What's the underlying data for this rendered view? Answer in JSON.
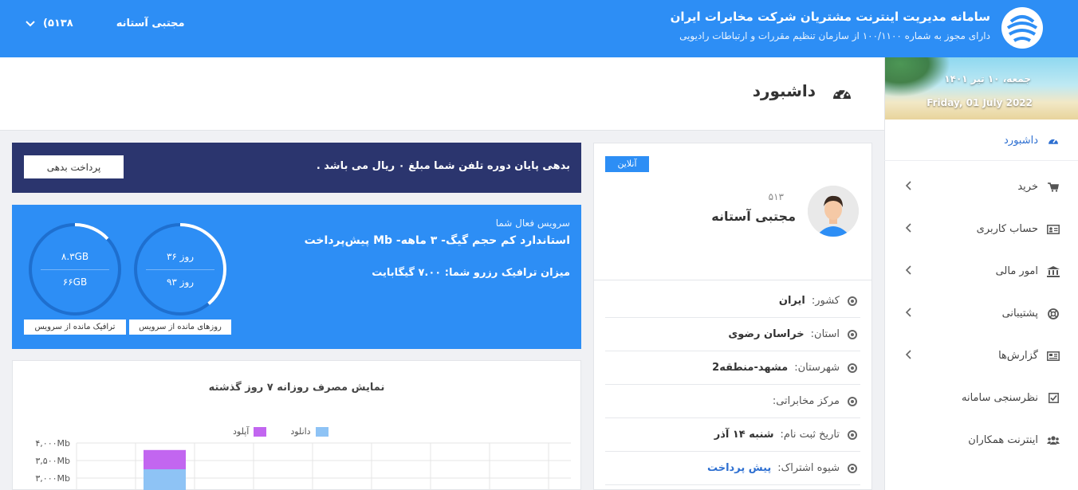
{
  "header": {
    "title": "سامانه مدیریت اینترنت مشتریان شرکت مخابرات ایران",
    "subtitle": "دارای مجوز به شماره ۱۰۰/۱۱۰۰ از سازمان تنظیم مقررات و ارتباطات رادیویی",
    "user_name": "مجتبی آستانه",
    "user_code": "(۵۱۳۸",
    "dropdown_icon": "chevron-down-icon"
  },
  "sidebar": {
    "date_fa": "جمعه، ۱۰ تیر ۱۴۰۱",
    "date_en": "Friday, 01 July 2022",
    "items": [
      {
        "label": "داشبورد",
        "icon": "dashboard-icon"
      },
      {
        "label": "خرید",
        "icon": "cart-icon"
      },
      {
        "label": "حساب کاربری",
        "icon": "id-card-icon"
      },
      {
        "label": "امور مالی",
        "icon": "bank-icon"
      },
      {
        "label": "پشتیبانی",
        "icon": "lifebuoy-icon"
      },
      {
        "label": "گزارش‌ها",
        "icon": "report-icon"
      },
      {
        "label": "نظرسنجی سامانه",
        "icon": "checkbox-icon"
      },
      {
        "label": "اینترنت همکاران",
        "icon": "users-icon"
      }
    ]
  },
  "page": {
    "title": "داشبورد"
  },
  "debt": {
    "message": "بدهی پایان دوره تلفن شما مبلغ ۰ ریال می باشد .",
    "pay_label": "پرداخت بدهی"
  },
  "service": {
    "heading": "سرویس فعال شما",
    "name": "استاندارد کم حجم      گیگ- ۳ ماهه- Mb    پیش‌پرداخت",
    "reserve": "میزان ترافیک رزرو شما:  ۷.۰۰  گیگابایت",
    "days_gauge": {
      "remaining": "۳۶ روز",
      "total": "۹۳ روز",
      "label": "روزهای مانده از سرویس",
      "fraction": 0.39
    },
    "traffic_gauge": {
      "remaining": "۸.۳GB",
      "total": "۶۶GB",
      "label": "ترافیک مانده از سرویس",
      "fraction": 0.13
    }
  },
  "chart": {
    "title": "نمایش مصرف روزانه ۷ روز گذشته",
    "legend_download": "دانلود",
    "legend_upload": "آپلود",
    "colors": {
      "download": "#8ec3f5",
      "upload": "#c266f0"
    }
  },
  "chart_data": {
    "type": "bar",
    "title": "نمایش مصرف روزانه ۷ روز گذشته",
    "y_ticks": [
      "۴,۰۰۰Mb",
      "۳,۵۰۰Mb",
      "۳,۰۰۰Mb"
    ],
    "ylim": [
      3000,
      4000
    ],
    "series": [
      {
        "name": "دانلود",
        "values": [
          3250
        ]
      },
      {
        "name": "آپلود",
        "values": [
          550
        ]
      }
    ]
  },
  "profile": {
    "status": "آنلاین",
    "user_id": "۵۱۳",
    "name": "مجتبی آستانه",
    "fields": [
      {
        "label": "کشور:",
        "value": "ایران"
      },
      {
        "label": "استان:",
        "value": "خراسان رضوی"
      },
      {
        "label": "شهرستان:",
        "value": "مشهد-منطقه2"
      },
      {
        "label": "مرکز مخابراتی:",
        "value": ""
      },
      {
        "label": "تاریخ ثبت نام:",
        "value": "شنبه ۱۴ آذر"
      },
      {
        "label": "شیوه اشتراک:",
        "value": "پیش پرداخت"
      }
    ]
  }
}
